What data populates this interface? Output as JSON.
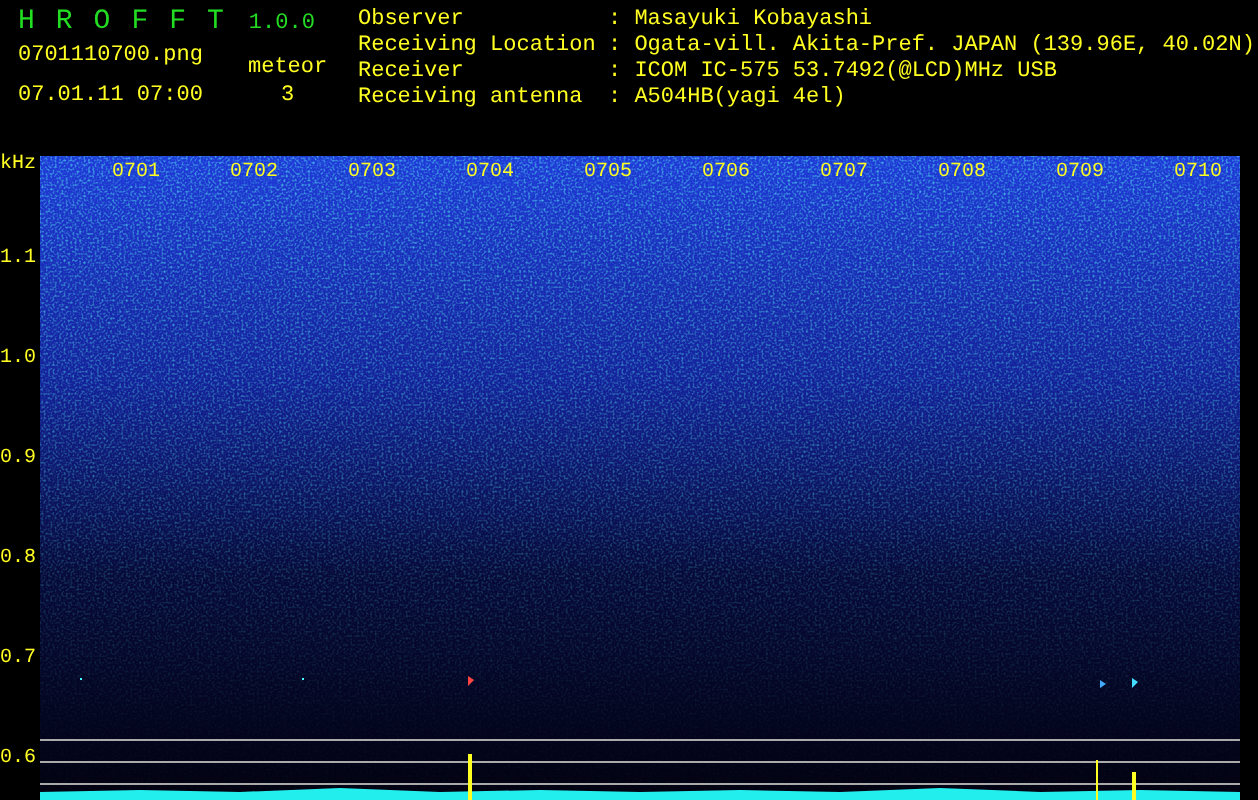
{
  "app": {
    "name": "HROFFT",
    "version": "1.0.0"
  },
  "file": "0701110700.png",
  "datetime": "07.01.11 07:00",
  "meteor": {
    "label": "meteor",
    "count": "3"
  },
  "station": [
    {
      "label": "Observer",
      "value": ": Masayuki Kobayashi"
    },
    {
      "label": "Receiving Location",
      "value": ": Ogata-vill. Akita-Pref. JAPAN (139.96E, 40.02N)"
    },
    {
      "label": "Receiver",
      "value": ": ICOM IC-575 53.7492(@LCD)MHz USB"
    },
    {
      "label": "Receiving antenna",
      "value": ": A504HB(yagi 4el)"
    }
  ],
  "spectrogram": {
    "unit": "kHz",
    "freq_labels": [
      "1.1",
      "1.0",
      "0.9",
      "0.8",
      "0.7",
      "0.6"
    ],
    "time_labels": [
      "0701",
      "0702",
      "0703",
      "0704",
      "0705",
      "0706",
      "0707",
      "0708",
      "0709",
      "0710"
    ]
  }
}
